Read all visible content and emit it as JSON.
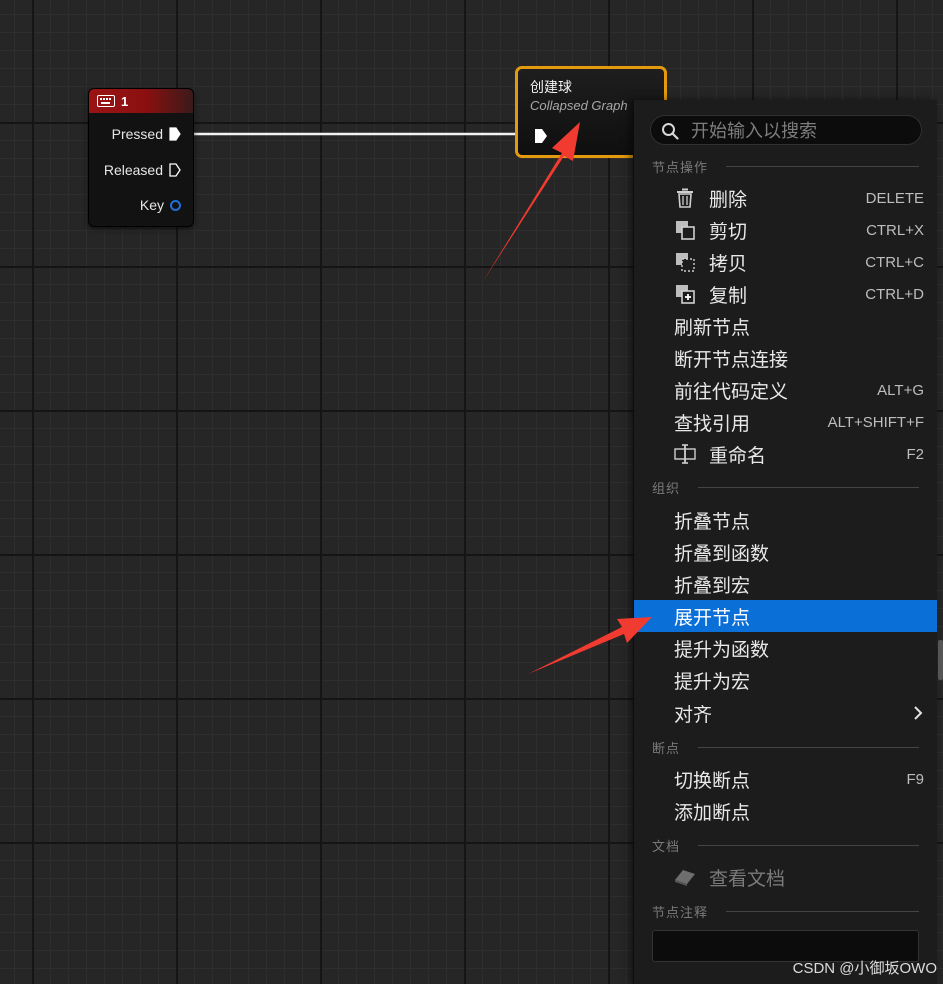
{
  "key_node": {
    "title": "1",
    "pins": {
      "pressed": "Pressed",
      "released": "Released",
      "key": "Key"
    }
  },
  "collapsed_node": {
    "title": "创建球",
    "subtitle": "Collapsed Graph"
  },
  "context_menu": {
    "search": {
      "placeholder": "开始输入以搜索"
    },
    "sections": {
      "node_actions": "节点操作",
      "organize": "组织",
      "breakpoints": "断点",
      "docs": "文档",
      "node_comment": "节点注释"
    },
    "node_actions": [
      {
        "label": "删除",
        "shortcut": "DELETE",
        "icon": "trash-icon"
      },
      {
        "label": "剪切",
        "shortcut": "CTRL+X",
        "icon": "cut-icon"
      },
      {
        "label": "拷贝",
        "shortcut": "CTRL+C",
        "icon": "copy-icon"
      },
      {
        "label": "复制",
        "shortcut": "CTRL+D",
        "icon": "duplicate-icon"
      },
      {
        "label": "刷新节点",
        "shortcut": ""
      },
      {
        "label": "断开节点连接",
        "shortcut": ""
      },
      {
        "label": "前往代码定义",
        "shortcut": "ALT+G"
      },
      {
        "label": "查找引用",
        "shortcut": "ALT+SHIFT+F"
      },
      {
        "label": "重命名",
        "shortcut": "F2",
        "icon": "rename-icon"
      }
    ],
    "organize": [
      {
        "label": "折叠节点"
      },
      {
        "label": "折叠到函数"
      },
      {
        "label": "折叠到宏"
      },
      {
        "label": "展开节点",
        "highlighted": true
      },
      {
        "label": "提升为函数"
      },
      {
        "label": "提升为宏"
      },
      {
        "label": "对齐",
        "submenu": true
      }
    ],
    "breakpoints": [
      {
        "label": "切换断点",
        "shortcut": "F9"
      },
      {
        "label": "添加断点",
        "shortcut": ""
      }
    ],
    "docs": [
      {
        "label": "查看文档",
        "disabled": true,
        "icon": "docs-icon"
      }
    ],
    "comment_value": ""
  },
  "watermark": "CSDN @小御坂OWO",
  "colors": {
    "highlight": "#0b6fd8",
    "collapsed_border": "#e49a10",
    "key_header": "#9a1414",
    "annotation_arrow": "#ff3b30"
  }
}
